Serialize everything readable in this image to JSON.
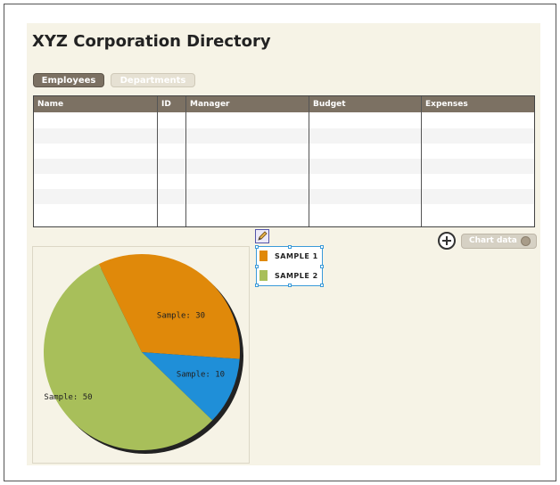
{
  "title": "XYZ Corporation Directory",
  "tabs": [
    {
      "label": "Employees",
      "active": true
    },
    {
      "label": "Departments",
      "active": false
    }
  ],
  "grid": {
    "columns": [
      "Name",
      "ID",
      "Manager",
      "Budget",
      "Expenses"
    ],
    "rows": []
  },
  "toolbar": {
    "chart_data_label": "Chart data"
  },
  "legend": {
    "items": [
      {
        "label": "SAMPLE 1",
        "color": "#e0890a"
      },
      {
        "label": "SAMPLE 2",
        "color": "#a8bf5a"
      }
    ]
  },
  "chart_data": {
    "type": "pie",
    "slices": [
      {
        "label": "Sample: 30",
        "value": 30,
        "color": "#e0890a"
      },
      {
        "label": "Sample: 10",
        "value": 10,
        "color": "#1f8fd8"
      },
      {
        "label": "Sample: 50",
        "value": 50,
        "color": "#a8bf5a"
      }
    ]
  },
  "colors": {
    "header_bg": "#7c7163",
    "stage_bg": "#f6f3e6",
    "selection": "#3a9ad9"
  }
}
